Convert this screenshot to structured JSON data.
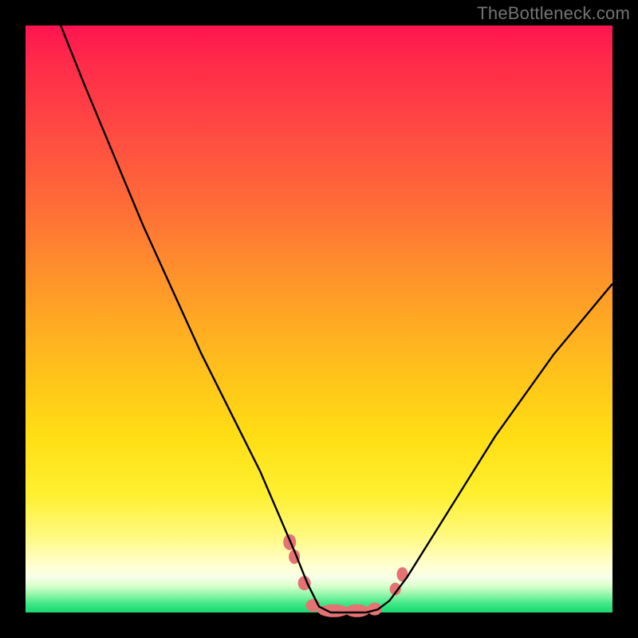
{
  "watermark": "TheBottleneck.com",
  "chart_data": {
    "type": "line",
    "title": "",
    "xlabel": "",
    "ylabel": "",
    "xlim": [
      0,
      100
    ],
    "ylim": [
      0,
      100
    ],
    "series": [
      {
        "name": "curve",
        "x": [
          6,
          10,
          15,
          20,
          25,
          30,
          35,
          40,
          43,
          46,
          48,
          50,
          52,
          55,
          58,
          60,
          62,
          65,
          70,
          75,
          80,
          85,
          90,
          95,
          100
        ],
        "values": [
          100,
          90,
          78,
          66,
          55,
          44,
          34,
          24,
          17,
          10,
          5,
          1,
          0,
          0,
          0,
          0.5,
          2,
          6,
          14,
          22,
          30,
          37,
          44,
          50,
          56
        ]
      }
    ],
    "markers": [
      {
        "x_pct": 45.0,
        "y_from_bottom_pct": 12.0,
        "rx": 8,
        "ry": 10
      },
      {
        "x_pct": 45.8,
        "y_from_bottom_pct": 9.5,
        "rx": 7,
        "ry": 9
      },
      {
        "x_pct": 47.5,
        "y_from_bottom_pct": 5.0,
        "rx": 8,
        "ry": 9
      },
      {
        "x_pct": 49.0,
        "y_from_bottom_pct": 1.2,
        "rx": 9,
        "ry": 8
      },
      {
        "x_pct": 52.5,
        "y_from_bottom_pct": 0.3,
        "rx": 20,
        "ry": 8
      },
      {
        "x_pct": 56.5,
        "y_from_bottom_pct": 0.3,
        "rx": 16,
        "ry": 8
      },
      {
        "x_pct": 59.5,
        "y_from_bottom_pct": 0.6,
        "rx": 9,
        "ry": 8
      },
      {
        "x_pct": 63.0,
        "y_from_bottom_pct": 4.0,
        "rx": 7,
        "ry": 8
      },
      {
        "x_pct": 64.2,
        "y_from_bottom_pct": 6.5,
        "rx": 7,
        "ry": 9
      }
    ],
    "colors": {
      "curve_stroke": "#000000",
      "marker_fill": "#e57373",
      "gradient_top": "#ff1450",
      "gradient_bottom": "#18d870",
      "frame": "#000000"
    }
  }
}
